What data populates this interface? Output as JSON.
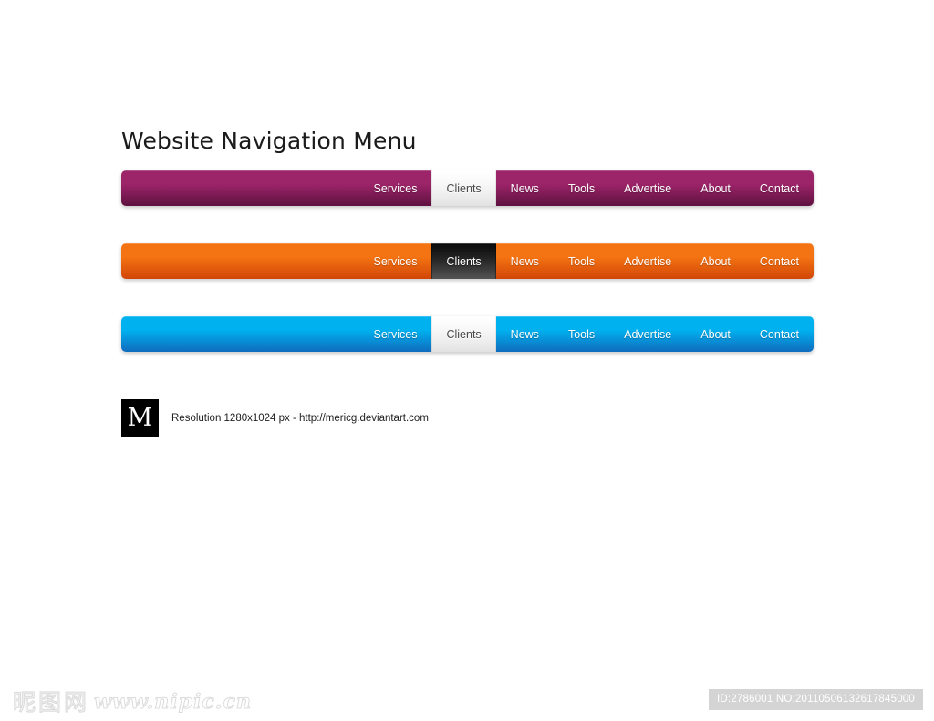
{
  "page": {
    "title": "Website Navigation Menu",
    "background_color": "#ffffff"
  },
  "navbars": [
    {
      "id": "purple",
      "theme_name": "purple",
      "gradient_top": "#9c2468",
      "gradient_bottom": "#5e1140",
      "active_style": "light",
      "active_bg_top": "#ffffff",
      "active_bg_bottom": "#e2e2e2",
      "active_text_color": "#4a4a4a",
      "items": [
        {
          "label": "Services",
          "active": false
        },
        {
          "label": "Clients",
          "active": true
        },
        {
          "label": "News",
          "active": false
        },
        {
          "label": "Tools",
          "active": false
        },
        {
          "label": "Advertise",
          "active": false
        },
        {
          "label": "About",
          "active": false
        },
        {
          "label": "Contact",
          "active": false
        }
      ]
    },
    {
      "id": "orange",
      "theme_name": "orange",
      "gradient_top": "#f47312",
      "gradient_bottom": "#d14607",
      "active_style": "dark",
      "active_bg_top": "#0a0a0a",
      "active_bg_bottom": "#545454",
      "active_text_color": "#ffffff",
      "items": [
        {
          "label": "Services",
          "active": false
        },
        {
          "label": "Clients",
          "active": true
        },
        {
          "label": "News",
          "active": false
        },
        {
          "label": "Tools",
          "active": false
        },
        {
          "label": "Advertise",
          "active": false
        },
        {
          "label": "About",
          "active": false
        },
        {
          "label": "Contact",
          "active": false
        }
      ]
    },
    {
      "id": "blue",
      "theme_name": "blue",
      "gradient_top": "#00b1ef",
      "gradient_bottom": "#0f6cbe",
      "active_style": "light",
      "active_bg_top": "#ffffff",
      "active_bg_bottom": "#e2e2e2",
      "active_text_color": "#4a4a4a",
      "items": [
        {
          "label": "Services",
          "active": false
        },
        {
          "label": "Clients",
          "active": true
        },
        {
          "label": "News",
          "active": false
        },
        {
          "label": "Tools",
          "active": false
        },
        {
          "label": "Advertise",
          "active": false
        },
        {
          "label": "About",
          "active": false
        },
        {
          "label": "Contact",
          "active": false
        }
      ]
    }
  ],
  "credit": {
    "logo_letter": "M",
    "text": "Resolution 1280x1024 px - http://mericg.deviantart.com"
  },
  "watermark": {
    "cjk_chars": [
      "昵",
      "图",
      "网"
    ],
    "url": "www.nipic.cn",
    "color": "#dcdcdc"
  },
  "id_badge": {
    "text": "ID:2786001 NO:20110506132617845000",
    "background_color": "#d4d4d4"
  }
}
